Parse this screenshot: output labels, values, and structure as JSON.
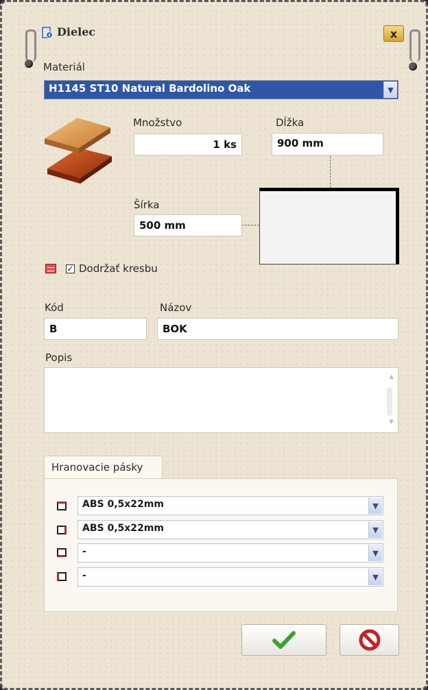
{
  "window": {
    "title": "Dielec",
    "close_label": "x"
  },
  "material": {
    "label": "Materiál",
    "value": "H1145 ST10 Natural Bardolino Oak"
  },
  "quantity": {
    "label": "Množstvo",
    "value": "1 ks"
  },
  "length": {
    "label": "Dĺžka",
    "value": "900 mm"
  },
  "width": {
    "label": "Šírka",
    "value": "500 mm"
  },
  "grain": {
    "label": "Dodržať kresbu",
    "checked": true
  },
  "code": {
    "label": "Kód",
    "value": "B"
  },
  "name": {
    "label": "Názov",
    "value": "BOK"
  },
  "description": {
    "label": "Popis",
    "value": ""
  },
  "edge_tab": {
    "label": "Hranovacie pásky"
  },
  "edges": [
    {
      "value": "ABS 0,5x22mm",
      "icon": "edge-top-icon"
    },
    {
      "value": "ABS 0,5x22mm",
      "icon": "edge-right-icon"
    },
    {
      "value": "-",
      "icon": "edge-bottom-icon"
    },
    {
      "value": "-",
      "icon": "edge-left-icon"
    }
  ],
  "colors": {
    "accent": "#2f57a5",
    "ok": "#3aa52b",
    "cancel": "#c4202a"
  }
}
